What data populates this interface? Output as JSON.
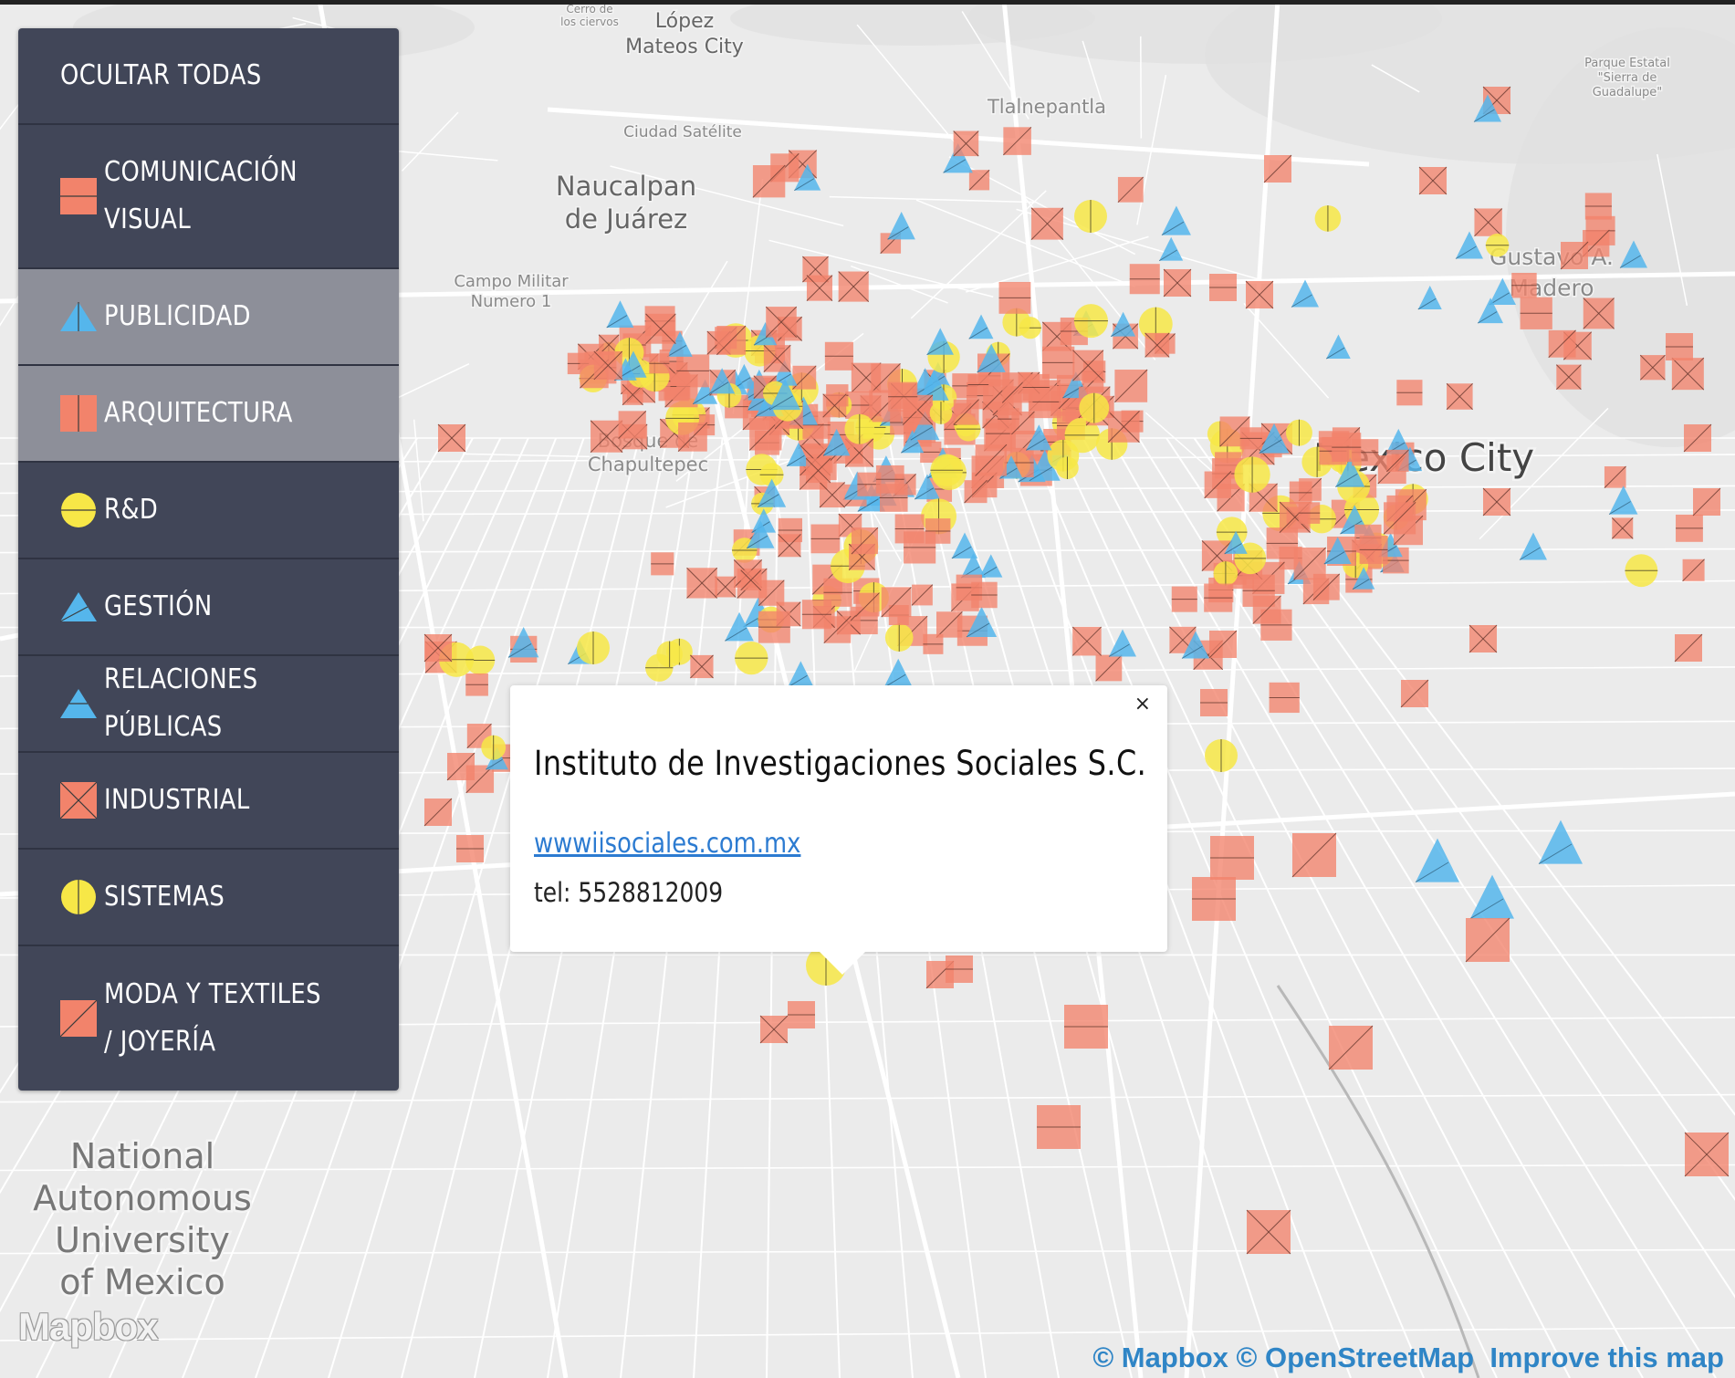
{
  "colors": {
    "square": "#f2836b",
    "triangle": "#55b6ec",
    "circle": "#f7e747",
    "sidebar": "#414658",
    "sidebar_off": "#8d8f99",
    "link": "#2c7bd1"
  },
  "sidebar": {
    "header": "OCULTAR TODAS",
    "items": [
      {
        "label": "COMUNICACIÓN VISUAL",
        "icon": "square-horizontal-icon",
        "active": true
      },
      {
        "label": "PUBLICIDAD",
        "icon": "triangle-vertical-icon",
        "active": false
      },
      {
        "label": "ARQUITECTURA",
        "icon": "square-vertical-icon",
        "active": false
      },
      {
        "label": "R&D",
        "icon": "circle-horizontal-icon",
        "active": true
      },
      {
        "label": "GESTIÓN",
        "icon": "triangle-diagonal-icon",
        "active": true
      },
      {
        "label": "RELACIONES PÚBLICAS",
        "icon": "triangle-horizontal-icon",
        "active": true
      },
      {
        "label": "INDUSTRIAL",
        "icon": "square-cross-icon",
        "active": true
      },
      {
        "label": "SISTEMAS",
        "icon": "circle-vertical-icon",
        "active": true
      },
      {
        "label": "MODA Y TEXTILES / JOYERÍA",
        "icon": "square-diagonal-icon",
        "active": true
      }
    ]
  },
  "popup": {
    "close": "×",
    "title": "Instituto de Investigaciones Sociales S.C.",
    "link": "wwwiisociales.com.mx",
    "tel": "tel: 5528812009"
  },
  "map": {
    "labels": [
      {
        "text": "Cerro de"
      },
      {
        "text": "los ciervos"
      },
      {
        "text": "López"
      },
      {
        "text": "Mateos City"
      },
      {
        "text": "Tlalnepantla"
      },
      {
        "text": "Parque Estatal"
      },
      {
        "text": "\"Sierra de"
      },
      {
        "text": "Guadalupe\""
      },
      {
        "text": "Ciudad Satélite"
      },
      {
        "text": "Naucalpan"
      },
      {
        "text": "de Juárez"
      },
      {
        "text": "Campo Militar"
      },
      {
        "text": "Numero 1"
      },
      {
        "text": "Gustavo A."
      },
      {
        "text": "Madero"
      },
      {
        "text": "Bosque de"
      },
      {
        "text": "Chapultepec"
      },
      {
        "text": "Mexico City"
      },
      {
        "text": "National"
      },
      {
        "text": "Autonomous"
      },
      {
        "text": "University"
      },
      {
        "text": "of Mexico"
      }
    ]
  },
  "attribution": {
    "mapbox": "© Mapbox",
    "osm": "© OpenStreetMap",
    "improve": "Improve this map"
  },
  "logo": "Mapbox"
}
